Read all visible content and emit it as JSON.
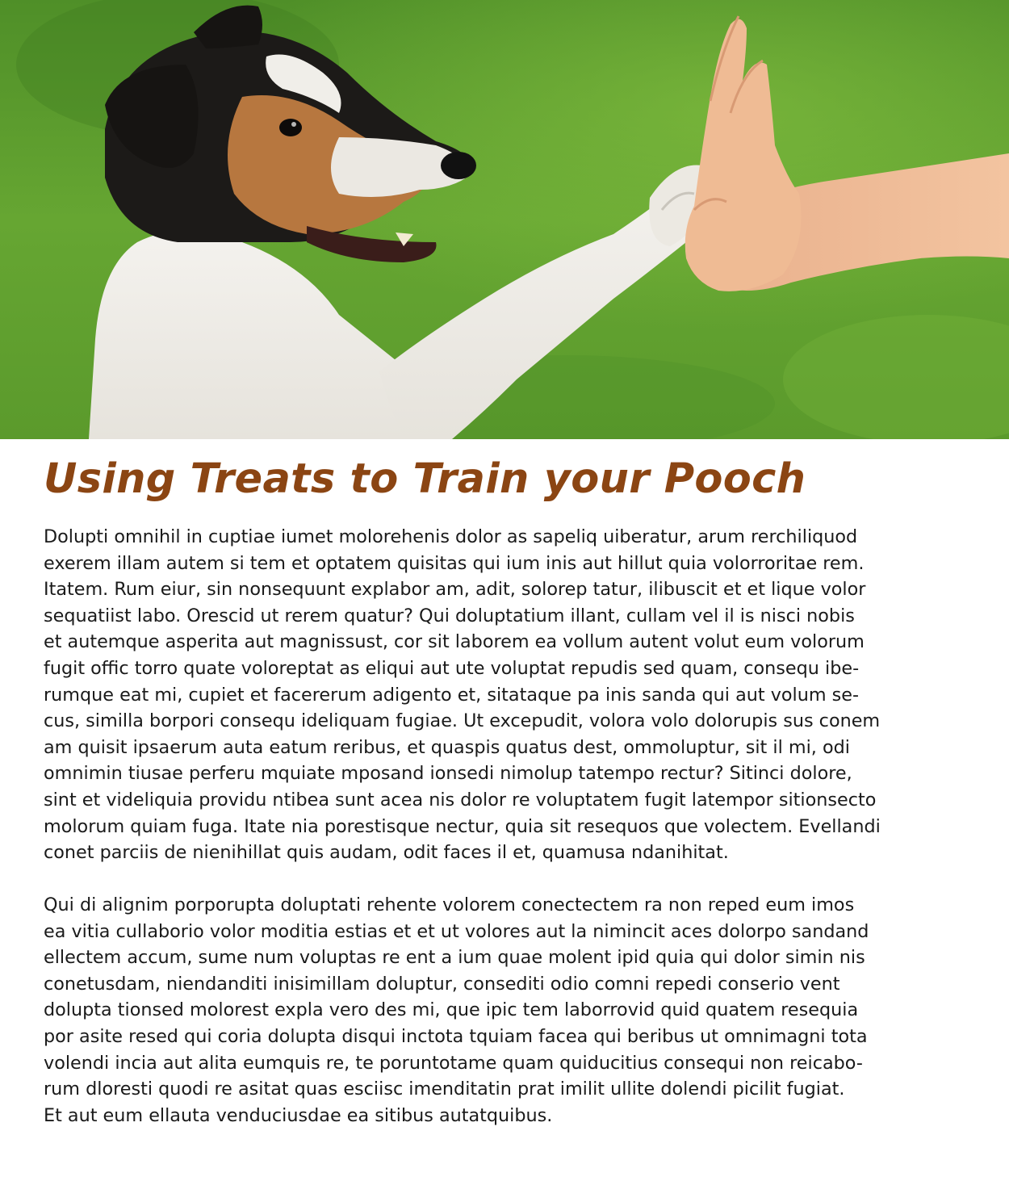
{
  "article": {
    "title": "Using Treats to Train your Pooch",
    "paragraphs": [
      {
        "lines": [
          "Dolupti omnihil in cuptiae iumet molorehenis dolor as sapeliq uiberatur, arum rerchiliquod",
          "exerem illam autem si tem et optatem quisitas qui ium inis aut hillut quia volorroritae rem.",
          "Itatem. Rum eiur, sin nonsequunt explabor am, adit, solorep tatur, ilibuscit et et lique volor",
          "sequatiist labo. Orescid ut rerem quatur? Qui doluptatium illant, cullam vel il is nisci nobis",
          "et autemque asperita aut magnissust, cor sit laborem ea vollum autent volut eum volorum",
          "fugit offic torro quate voloreptat as eliqui aut ute voluptat repudis sed quam, consequ ibe-",
          "rumque eat mi, cupiet et facererum adigento et, sitataque pa inis sanda qui aut volum se-",
          "cus, similla borpori consequ ideliquam fugiae. Ut excepudit, volora volo dolorupis sus conem",
          "am quisit ipsaerum auta eatum reribus, et quaspis quatus dest, ommoluptur, sit il mi, odi",
          "omnimin tiusae perferu mquiate mposand ionsedi nimolup tatempo rectur? Sitinci dolore,",
          "sint et videliquia providu ntibea sunt acea nis dolor re voluptatem fugit latempor sitionsecto",
          "molorum quiam fuga. Itate nia porestisque nectur, quia sit resequos que volectem. Evellandi",
          "conet parciis de nienihillat quis audam, odit faces il et, quamusa ndanihitat."
        ]
      },
      {
        "lines": [
          "Qui di alignim porporupta doluptati rehente volorem conectectem ra non reped eum imos",
          "ea vitia cullaborio volor moditia estias et et ut volores aut la nimincit aces dolorpo sandand",
          "ellectem accum, sume num voluptas re ent a ium quae molent ipid quia qui dolor simin nis",
          "conetusdam, niendanditi inisimillam doluptur, consediti odio comni repedi conserio vent",
          "dolupta tionsed molorest expla vero des mi, que ipic tem laborrovid quid quatem resequia",
          "por asite resed qui coria dolupta disqui inctota tquiam facea qui beribus ut omnimagni tota",
          "volendi incia aut alita eumquis re, te poruntotame quam quiducitius consequi non reicabo-",
          "rum dloresti quodi re asitat quas esciisc imenditatin prat imilit ullite dolendi picilit fugiat.",
          "Et aut eum ellauta venduciusdae ea sitibus autatquibus."
        ]
      }
    ]
  },
  "colors": {
    "title": "#8b4513",
    "body_text": "#1a1a1a",
    "grass": "#5d9c2f",
    "background": "#ffffff"
  }
}
